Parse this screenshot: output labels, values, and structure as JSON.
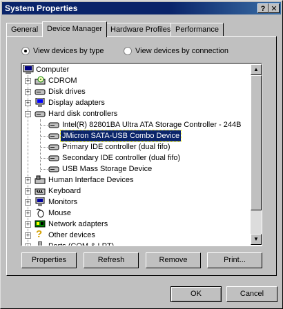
{
  "window": {
    "title": "System Properties",
    "help_button": "?",
    "close_button": "✕"
  },
  "tabs": [
    "General",
    "Device Manager",
    "Hardware Profiles",
    "Performance"
  ],
  "active_tab": "Device Manager",
  "view_options": {
    "by_type": "View devices by type",
    "by_connection": "View devices by connection",
    "selected": "by_type"
  },
  "tree": {
    "root": "Computer",
    "categories": [
      "CDROM",
      "Disk drives",
      "Display adapters",
      "Hard disk controllers",
      "Human Interface Devices",
      "Keyboard",
      "Monitors",
      "Mouse",
      "Network adapters",
      "Other devices",
      "Ports (COM & LPT)"
    ],
    "hdc_children": [
      "Intel(R) 82801BA Ultra ATA Storage Controller - 244B",
      "JMicron SATA-USB Combo Device",
      "Primary IDE controller (dual fifo)",
      "Secondary IDE controller (dual fifo)",
      "USB Mass Storage Device"
    ],
    "selected": "JMicron SATA-USB Combo Device"
  },
  "action_buttons": {
    "properties": "Properties",
    "refresh": "Refresh",
    "remove": "Remove",
    "print": "Print..."
  },
  "dialog_buttons": {
    "ok": "OK",
    "cancel": "Cancel"
  },
  "colors": {
    "face": "#c0c0c0",
    "title_bar": "#0a246a",
    "selection": "#0a246a"
  }
}
